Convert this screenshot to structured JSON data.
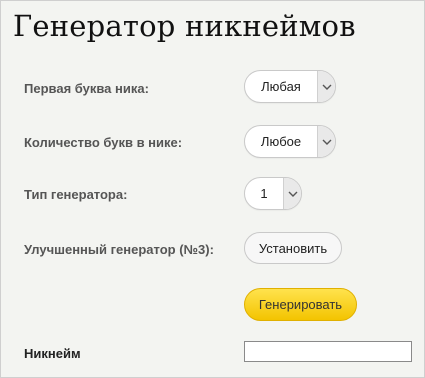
{
  "title": "Генератор никнеймов",
  "rows": [
    {
      "label": "Первая буква ника:",
      "value": "Любая"
    },
    {
      "label": "Количество букв в нике:",
      "value": "Любое"
    },
    {
      "label": "Тип генератора:",
      "value": "1"
    },
    {
      "label": "Улучшенный генератор (№3):",
      "button": "Установить"
    }
  ],
  "generate_button": "Генерировать",
  "nickname": {
    "label": "Никнейм",
    "value": ""
  },
  "icons": {
    "dropdown": "chevron-down-icon"
  },
  "colors": {
    "generate_button": "#f7cf12",
    "background": "#f3f4f1"
  }
}
